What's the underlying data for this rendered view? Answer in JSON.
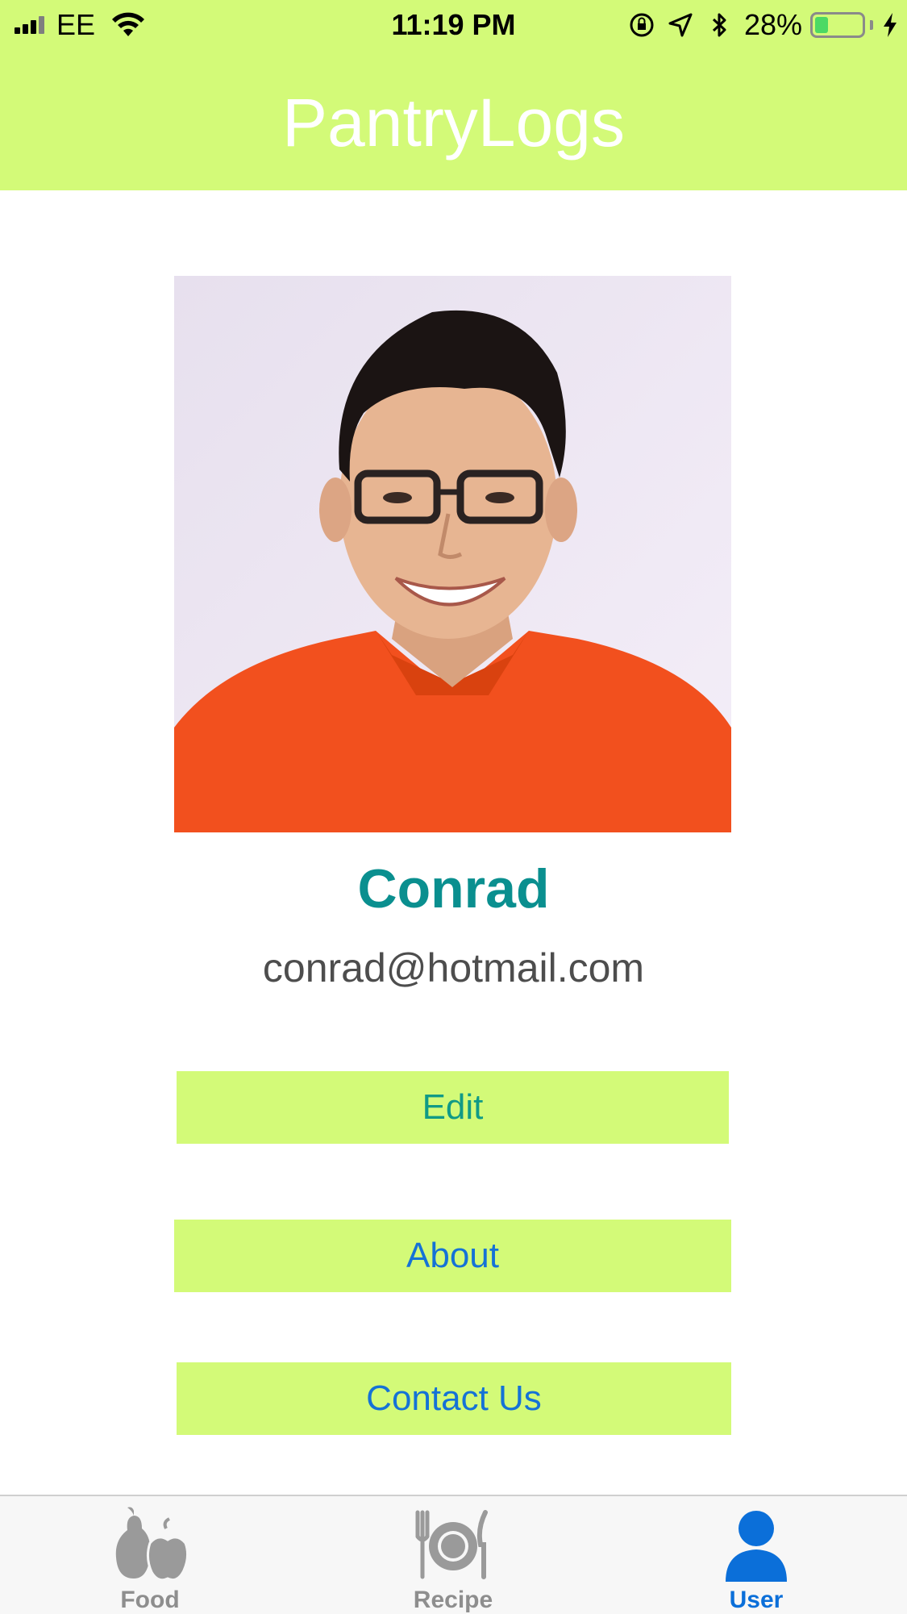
{
  "status_bar": {
    "carrier": "EE",
    "time": "11:19 PM",
    "battery_percent": "28%",
    "battery_level": 0.28,
    "icons": [
      "signal-icon",
      "wifi-icon",
      "orientation-lock-icon",
      "location-icon",
      "bluetooth-icon",
      "battery-icon",
      "charging-icon"
    ]
  },
  "header": {
    "title": "PantryLogs"
  },
  "profile": {
    "name": "Conrad",
    "email": "conrad@hotmail.com"
  },
  "buttons": {
    "edit": "Edit",
    "about": "About",
    "contact": "Contact Us"
  },
  "tabbar": {
    "tabs": [
      {
        "label": "Food",
        "icon": "food-icon",
        "active": false
      },
      {
        "label": "Recipe",
        "icon": "recipe-icon",
        "active": false
      },
      {
        "label": "User",
        "icon": "user-icon",
        "active": true
      }
    ]
  },
  "colors": {
    "accent": "#d3fa78",
    "name": "#0a8f8f",
    "edit_text": "#109a86",
    "link_text": "#1572d6",
    "tab_active": "#0b6fd9",
    "tab_inactive": "#8e8e8e"
  }
}
